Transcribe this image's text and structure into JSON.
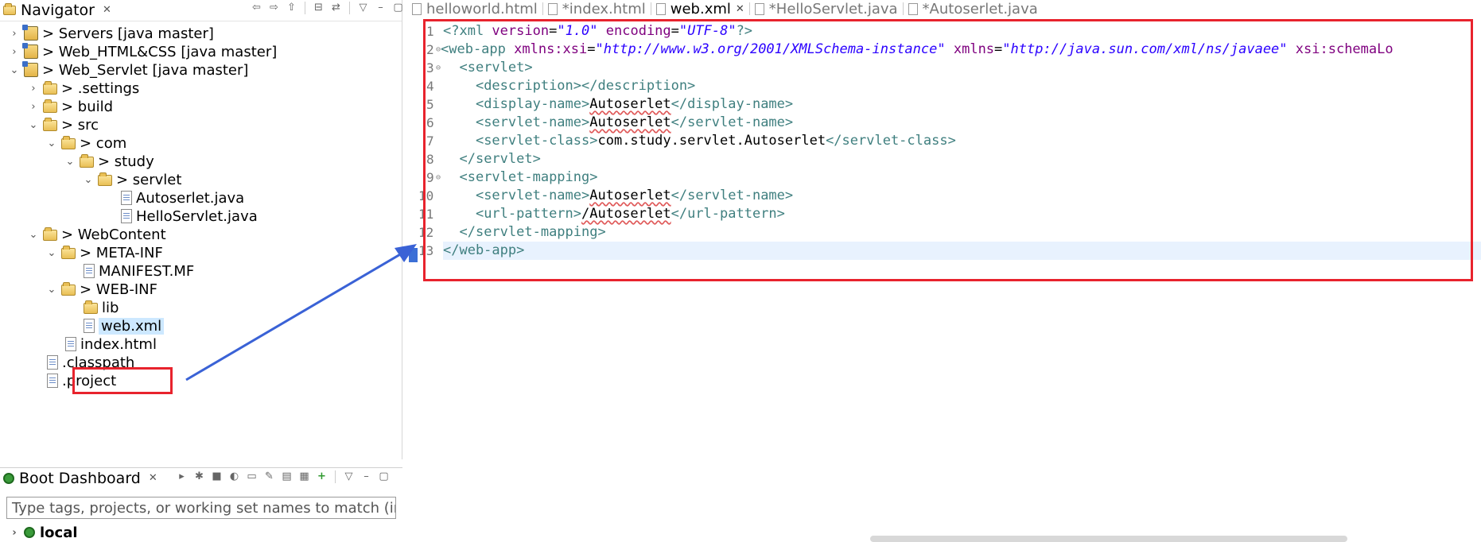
{
  "navigator": {
    "title": "Navigator",
    "tree": [
      {
        "label": "> Servers [java master]",
        "icon": "project",
        "expanded": false
      },
      {
        "label": "> Web_HTML&CSS [java master]",
        "icon": "project",
        "expanded": false
      },
      {
        "label": "> Web_Servlet [java master]",
        "icon": "project",
        "expanded": true
      },
      {
        "label": "> .settings",
        "icon": "folder",
        "expanded": false
      },
      {
        "label": "> build",
        "icon": "folder",
        "expanded": false
      },
      {
        "label": "> src",
        "icon": "folder",
        "expanded": true
      },
      {
        "label": "> com",
        "icon": "folder",
        "expanded": true
      },
      {
        "label": "> study",
        "icon": "folder",
        "expanded": true
      },
      {
        "label": "> servlet",
        "icon": "folder",
        "expanded": true
      },
      {
        "label": "Autoserlet.java",
        "icon": "java-file"
      },
      {
        "label": "HelloServlet.java",
        "icon": "java-file"
      },
      {
        "label": "> WebContent",
        "icon": "folder",
        "expanded": true
      },
      {
        "label": "> META-INF",
        "icon": "folder",
        "expanded": true
      },
      {
        "label": "MANIFEST.MF",
        "icon": "file"
      },
      {
        "label": "> WEB-INF",
        "icon": "folder",
        "expanded": true
      },
      {
        "label": "lib",
        "icon": "folder"
      },
      {
        "label": "web.xml",
        "icon": "xml-file",
        "selected": true
      },
      {
        "label": "index.html",
        "icon": "file"
      },
      {
        "label": ".classpath",
        "icon": "file"
      },
      {
        "label": ".project",
        "icon": "file"
      }
    ]
  },
  "boot_dashboard": {
    "title": "Boot Dashboard",
    "filter_placeholder": "Type tags, projects, or working set names to match (incl.",
    "local_label": "local"
  },
  "editor": {
    "tabs": [
      {
        "label": "helloworld.html",
        "active": false
      },
      {
        "label": "*index.html",
        "active": false
      },
      {
        "label": "web.xml",
        "active": true
      },
      {
        "label": "*HelloServlet.java",
        "active": false
      },
      {
        "label": "*Autoserlet.java",
        "active": false
      }
    ],
    "line_numbers": [
      "1",
      "2",
      "3",
      "4",
      "5",
      "6",
      "7",
      "8",
      "9",
      "10",
      "11",
      "12",
      "13"
    ],
    "code": {
      "l1_open": "<?xml ",
      "l1_attr1": "version",
      "l1_val1": "\"1.0\"",
      "l1_attr2": "encoding",
      "l1_val2": "\"UTF-8\"",
      "l1_close": "?>",
      "l2_open": "<web-app ",
      "l2_attr1": "xmlns:xsi",
      "l2_val1": "\"http://www.w3.org/2001/XMLSchema-instance\"",
      "l2_attr2": "xmlns",
      "l2_val2": "\"http://java.sun.com/xml/ns/javaee\"",
      "l2_attr3": "xsi:schemaLo",
      "l3": "<servlet>",
      "l4": "<description></description>",
      "l5_open": "<display-name>",
      "l5_text": "Autoserlet",
      "l5_close": "</display-name>",
      "l6_open": "<servlet-name>",
      "l6_text": "Autoserlet",
      "l6_close": "</servlet-name>",
      "l7_open": "<servlet-class>",
      "l7_text": "com.study.servlet.Autoserlet",
      "l7_close": "</servlet-class>",
      "l8": "</servlet>",
      "l9": "<servlet-mapping>",
      "l10_open": "<servlet-name>",
      "l10_text": "Autoserlet",
      "l10_close": "</servlet-name>",
      "l11_open": "<url-pattern>",
      "l11_text": "/Autoserlet",
      "l11_close": "</url-pattern>",
      "l12": "</servlet-mapping>",
      "l13": "</web-app>"
    }
  },
  "colors": {
    "highlight_box": "#e8232d",
    "arrow": "#3a62d6",
    "tag": "#3f7f7f",
    "attribute": "#7f007f",
    "value": "#2a00ff"
  }
}
